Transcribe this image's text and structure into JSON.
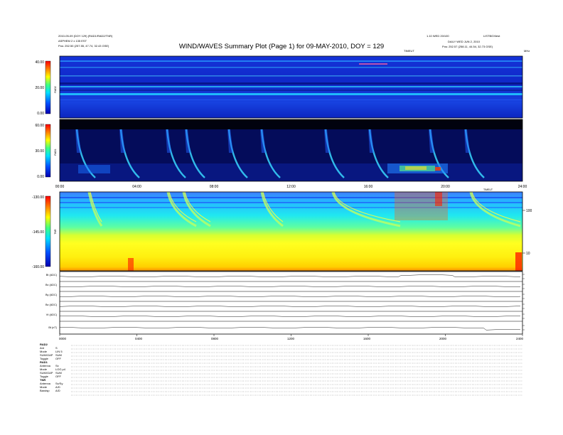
{
  "header": {
    "title": "WIND/WAVES Summary Plot (Page 1) for 09-MAY-2010, DOY = 129",
    "left_line1": "2010-05-09 (DOY 129) (RAD1/RAD2/TNR)",
    "left_line2": "ASPHEM 2 x 135 EST",
    "left_line3": "Pos: 252.50 (257.55, 47.74, 32.43 GSE)",
    "right_line1": "1.10 WED 20/100",
    "right_line2": "LISTBOXtest",
    "right_line3": "DAILY WED JUN 2, 2010",
    "right_line4": "Pos: 252.57 (258.11, 44.54, 32.73 GSE)",
    "mhz_label": "MHz",
    "time_label": "TIMEUT"
  },
  "chart_data": [
    {
      "type": "heatmap",
      "panel": "RAD2",
      "ylabel": "RAD2",
      "yticks": [
        "40.00",
        "20.00",
        "0.00"
      ],
      "ylim": [
        0,
        40
      ]
    },
    {
      "type": "heatmap",
      "panel": "RAD1",
      "ylabel": "RAD1",
      "yticks": [
        "60.00",
        "30.00",
        "0.00"
      ],
      "ylim": [
        0,
        60
      ],
      "xticks": [
        "00:00",
        "04:00",
        "08:00",
        "12:00",
        "16:00",
        "20:00",
        "24:00"
      ],
      "xlabel_right": "TIMEUT"
    },
    {
      "type": "heatmap",
      "panel": "TNR",
      "ylabel": "TNR",
      "yticks": [
        "-130.00",
        "-145.00",
        "-160.00"
      ],
      "ylim": [
        -160,
        -130
      ],
      "right_ticks": [
        "100",
        "10"
      ]
    },
    {
      "type": "line",
      "panel": "housekeeping",
      "series": [
        {
          "name": "Bt (ADC)"
        },
        {
          "name": "Bx (ADC)"
        },
        {
          "name": "By (ADC)"
        },
        {
          "name": "Bz (ADC)"
        },
        {
          "name": "Vt (ADC)"
        },
        {
          "name": "Bt (nT)"
        }
      ],
      "xticks": [
        "0000",
        "0400",
        "0800",
        "1200",
        "1600",
        "2000",
        "2400"
      ]
    }
  ],
  "footer": {
    "groups": [
      {
        "title": "RAD2",
        "rows": [
          [
            "Ant",
            "S"
          ],
          [
            "Mode",
            "LIN 5"
          ],
          [
            "SUM/GAP",
            "SUM"
          ],
          [
            "Toggle",
            "OFF"
          ]
        ]
      },
      {
        "title": "RAD1",
        "rows": [
          [
            "Antenna",
            "Sx"
          ],
          [
            "Mode",
            "LOG p4"
          ],
          [
            "SUM/GAP",
            "SUM"
          ],
          [
            "Toggle",
            "OFF"
          ]
        ]
      },
      {
        "title": "TNR",
        "rows": [
          [
            "Antenna",
            "Sx/Sy"
          ],
          [
            "Mode",
            "A/D"
          ],
          [
            "Bandsp",
            "A/D"
          ]
        ]
      }
    ]
  }
}
